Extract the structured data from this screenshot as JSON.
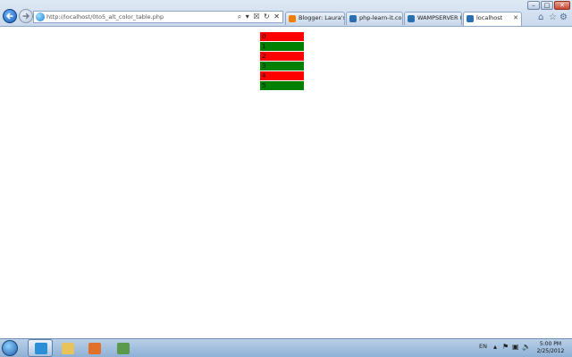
{
  "browser": {
    "address": "http://localhost/0to5_alt_color_table.php",
    "address_tools": "⌕ ▾ ☒ ↻ ✕",
    "tabs": [
      {
        "label": "Blogger: Laura's E...",
        "icon_color": "#f57d00",
        "active": false
      },
      {
        "label": "php-learn-it.com",
        "icon_color": "#2a6fb0",
        "active": false
      },
      {
        "label": "WAMPSERVER H...",
        "icon_color": "#2a6fb0",
        "active": false
      },
      {
        "label": "localhost",
        "icon_color": "#2a6fb0",
        "active": true
      }
    ],
    "tab_close": "✕",
    "window_controls": {
      "minimize": "–",
      "maximize": "□",
      "close": "✕"
    },
    "toolbar_icons": [
      "home-icon",
      "favorites-star-icon",
      "tools-gear-icon"
    ],
    "toolbar_glyphs": {
      "home": "⌂",
      "favorites": "☆",
      "tools": "⚙"
    }
  },
  "table": {
    "rows": [
      {
        "text": "0",
        "color": "#ff0000"
      },
      {
        "text": "1",
        "color": "#008000"
      },
      {
        "text": "2",
        "color": "#ff0000"
      },
      {
        "text": "3",
        "color": "#008000"
      },
      {
        "text": "4",
        "color": "#ff0000"
      },
      {
        "text": "5",
        "color": "#008000"
      }
    ]
  },
  "taskbar": {
    "pinned": [
      {
        "name": "internet-explorer-icon",
        "active": true,
        "color": "#2a8fd6"
      },
      {
        "name": "windows-explorer-icon",
        "active": false,
        "color": "#e8c25a"
      },
      {
        "name": "media-player-icon",
        "active": false,
        "color": "#e0702a"
      },
      {
        "name": "network-app-icon",
        "active": false,
        "color": "#5a9a4a"
      }
    ],
    "tray": {
      "language": "EN",
      "icons": {
        "arrow": "▴",
        "flag": "⚑",
        "network": "▣",
        "volume": "🔈"
      },
      "time": "5:00 PM",
      "date": "2/25/2012"
    }
  }
}
